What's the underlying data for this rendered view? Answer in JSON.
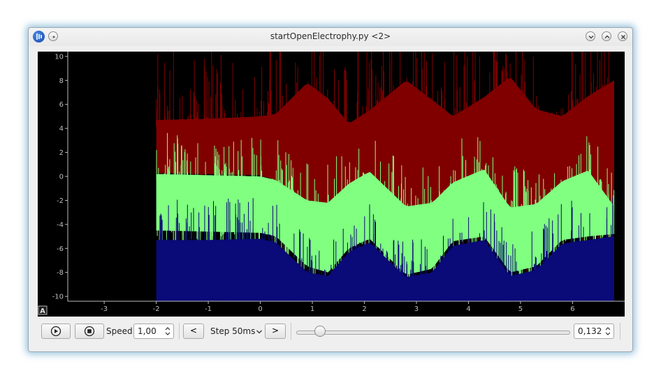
{
  "window": {
    "title": "startOpenElectrophy.py <2>",
    "icons": [
      "app-icon",
      "pin-icon",
      "minimize-icon",
      "maximize-icon",
      "close-icon"
    ]
  },
  "chart_data": {
    "type": "line",
    "title": "",
    "xlabel": "",
    "ylabel": "",
    "xlim": [
      -3.7,
      6.8
    ],
    "ylim": [
      -10.4,
      10.4
    ],
    "x_ticks": [
      -3,
      -2,
      -1,
      0,
      1,
      2,
      3,
      4,
      5,
      6
    ],
    "y_ticks": [
      10,
      8,
      6,
      4,
      2,
      0,
      -2,
      -4,
      -6,
      -8,
      -10
    ],
    "grid": false,
    "background": "#000000",
    "signal_start_x": -2,
    "series": [
      {
        "color": "#800000",
        "x": [
          -2,
          -1,
          0,
          0.3,
          0.9,
          1.3,
          1.7,
          2.1,
          2.8,
          3.3,
          3.7,
          4.3,
          4.8,
          5.3,
          5.8,
          6.3,
          6.8
        ],
        "y_high": [
          4.7,
          4.8,
          5.0,
          5.2,
          7.8,
          6.5,
          4.4,
          5.5,
          8.0,
          6.4,
          5.0,
          6.6,
          8.3,
          5.6,
          5.0,
          6.7,
          8.0
        ],
        "y_low": [
          0.3,
          0.2,
          0.1,
          -0.3,
          -2.0,
          -2.4,
          -1.0,
          -0.8,
          -2.8,
          -2.6,
          -0.7,
          -1.0,
          -2.9,
          -2.6,
          -0.8,
          -1.0,
          -2.9
        ]
      },
      {
        "color": "#80ff80",
        "x": [
          -2,
          -1,
          0,
          0.3,
          0.9,
          1.3,
          1.7,
          2.1,
          2.8,
          3.3,
          3.7,
          4.3,
          4.8,
          5.3,
          5.8,
          6.3,
          6.8
        ],
        "y_high": [
          0.2,
          0.1,
          0.0,
          -0.3,
          -2.0,
          -2.2,
          -0.6,
          0.4,
          -2.5,
          -2.2,
          -0.5,
          0.6,
          -2.6,
          -2.3,
          -0.4,
          0.5,
          -2.5
        ],
        "y_low": [
          -4.5,
          -4.6,
          -4.7,
          -5.0,
          -7.5,
          -8.0,
          -6.0,
          -5.2,
          -8.2,
          -7.7,
          -5.4,
          -5.0,
          -8.0,
          -7.5,
          -5.3,
          -5.0,
          -4.8
        ]
      },
      {
        "color": "#0a0a78",
        "x": [
          -2,
          -1,
          0,
          0.3,
          0.9,
          1.3,
          1.7,
          2.1,
          2.8,
          3.3,
          3.7,
          4.3,
          4.8,
          5.3,
          5.8,
          6.3,
          6.8
        ],
        "y_high": [
          -5.3,
          -5.3,
          -5.2,
          -5.5,
          -8.0,
          -8.3,
          -6.3,
          -5.5,
          -8.4,
          -8.0,
          -5.8,
          -5.3,
          -8.3,
          -7.8,
          -5.6,
          -5.3,
          -5.0
        ],
        "y_low": [
          -10.4,
          -10.4,
          -10.4,
          -10.4,
          -10.4,
          -10.4,
          -10.4,
          -10.4,
          -10.4,
          -10.4,
          -10.4,
          -10.4,
          -10.4,
          -10.4,
          -10.4,
          -10.4,
          -10.4
        ]
      }
    ]
  },
  "plot": {
    "autorange_label": "A"
  },
  "toolbar": {
    "speed_label": "Speed:",
    "speed_value": "1,00",
    "prev_label": "<",
    "step_label": "Step 50ms",
    "next_label": ">",
    "time_value": "0,132",
    "slider_position": 0.07
  }
}
